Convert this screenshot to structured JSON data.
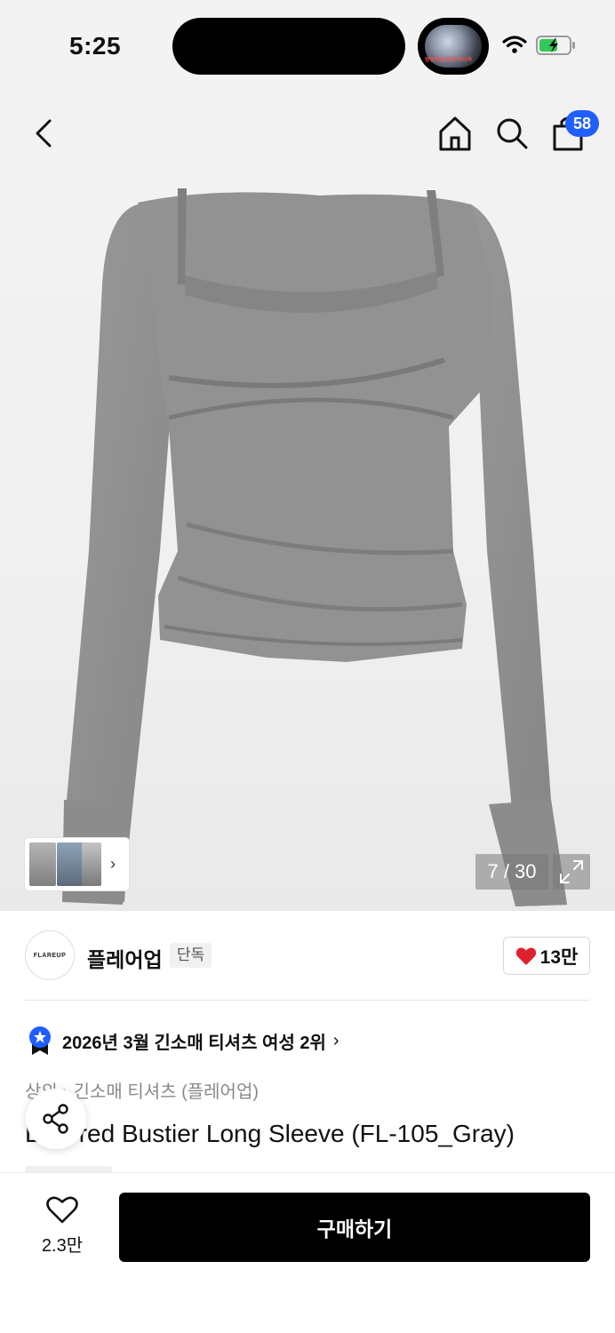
{
  "status_bar": {
    "time": "5:25",
    "live_caption": "방송하실 일로 하시라"
  },
  "header": {
    "cart_count": "58"
  },
  "gallery": {
    "counter": "7 / 30"
  },
  "brand": {
    "logo_text": "FLAREUP",
    "name": "플레어업",
    "tag": "단독",
    "likes": "13만"
  },
  "ranking": {
    "text": "2026년 3월 긴소매 티셔츠 여성 2위",
    "chevron": "›"
  },
  "breadcrumb": "상의 › 긴소매 티셔츠 (플레어업)",
  "product_title": "Layered Bustier Long Sleeve (FL-105_Gray)",
  "bottom_bar": {
    "wish_count": "2.3만",
    "buy_label": "구매하기"
  },
  "colors": {
    "accent_blue": "#1f5eff",
    "like_red": "#e0202e",
    "garment_gray": "#8f8f8f"
  }
}
